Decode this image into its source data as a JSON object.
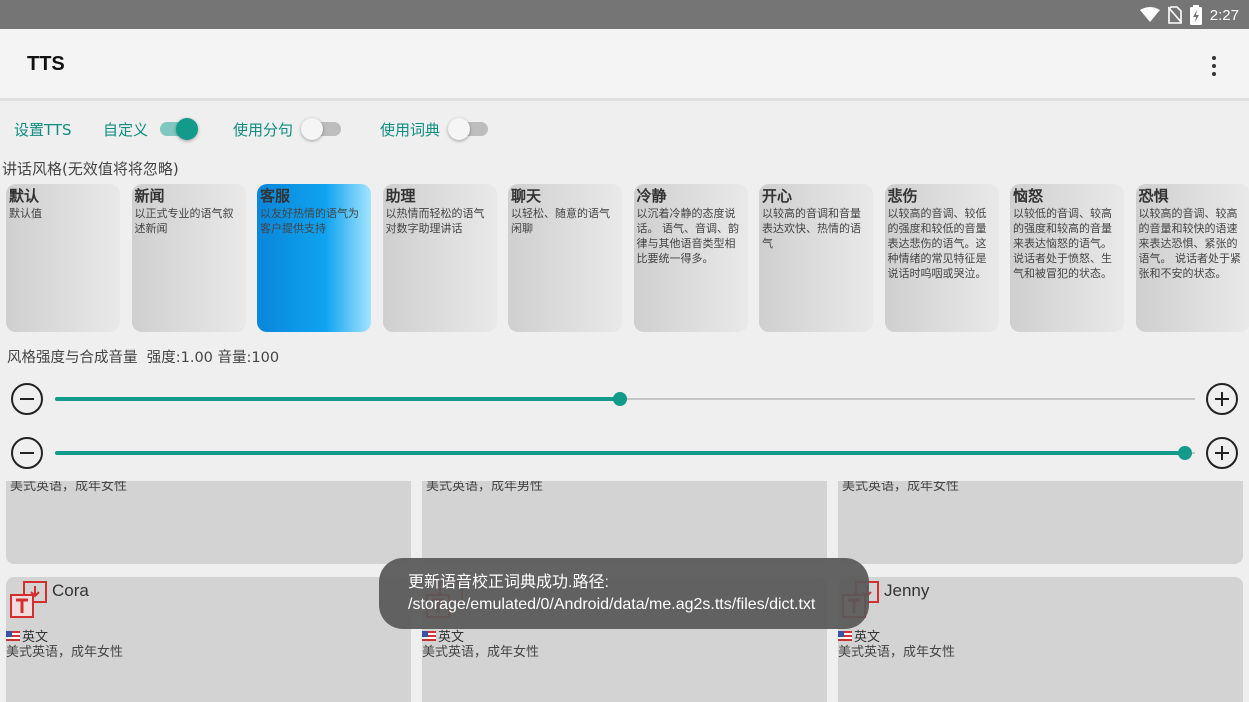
{
  "status": {
    "time": "2:27",
    "icons": [
      "wifi-icon",
      "no-sim-icon",
      "battery-charging-icon"
    ]
  },
  "appbar": {
    "title": "TTS",
    "menu_icon": "more-vert-icon"
  },
  "options": {
    "set_tts": "设置TTS",
    "custom": {
      "label": "自定义",
      "on": true
    },
    "split": {
      "label": "使用分句",
      "on": false
    },
    "dict": {
      "label": "使用词典",
      "on": false
    },
    "accent": "#129a8b"
  },
  "style_section": {
    "label": "讲话风格(无效值将将忽略)"
  },
  "styles": [
    {
      "name": "默认",
      "desc": "默认值",
      "selected": false
    },
    {
      "name": "新闻",
      "desc": "以正式专业的语气叙述新闻",
      "selected": false
    },
    {
      "name": "客服",
      "desc": "以友好热情的语气为客户提供支持",
      "selected": true
    },
    {
      "name": "助理",
      "desc": "以热情而轻松的语气对数字助理讲话",
      "selected": false
    },
    {
      "name": "聊天",
      "desc": "以轻松、随意的语气闲聊",
      "selected": false
    },
    {
      "name": "冷静",
      "desc": "以沉着冷静的态度说话。 语气、音调、韵律与其他语音类型相比要统一得多。",
      "selected": false
    },
    {
      "name": "开心",
      "desc": "以较高的音调和音量表达欢快、热情的语气",
      "selected": false
    },
    {
      "name": "悲伤",
      "desc": "以较高的音调、较低的强度和较低的音量表达悲伤的语气。这种情绪的常见特征是说话时呜咽或哭泣。",
      "selected": false
    },
    {
      "name": "恼怒",
      "desc": "以较低的音调、较高的强度和较高的音量来表达恼怒的语气。说话者处于愤怒、生气和被冒犯的状态。",
      "selected": false
    },
    {
      "name": "恐惧",
      "desc": "以较高的音调、较高的音量和较快的语速来表达恐惧、紧张的语气。 说话者处于紧张和不安的状态。",
      "selected": false
    }
  ],
  "strength": {
    "label": "风格强度与合成音量",
    "values_text": "强度:1.00 音量:100",
    "strength_fraction": 0.5,
    "volume_fraction": 1.0
  },
  "voices": {
    "top_row_cut_text": [
      "美式英语，成年女性",
      "美式英语，成年男性",
      "美式英语，成年女性"
    ],
    "cards": [
      {
        "name": "Cora",
        "lang": "英文",
        "desc": "美式英语，成年女性"
      },
      {
        "name": "",
        "lang": "英文",
        "desc": "美式英语，成年女性"
      },
      {
        "name": "Jenny",
        "lang": "英文",
        "desc": "美式英语，成年女性"
      }
    ]
  },
  "toast": {
    "line1": "更新语音校正词典成功.路径:",
    "line2": "/storage/emulated/0/Android/data/me.ag2s.tts/files/dict.txt"
  }
}
